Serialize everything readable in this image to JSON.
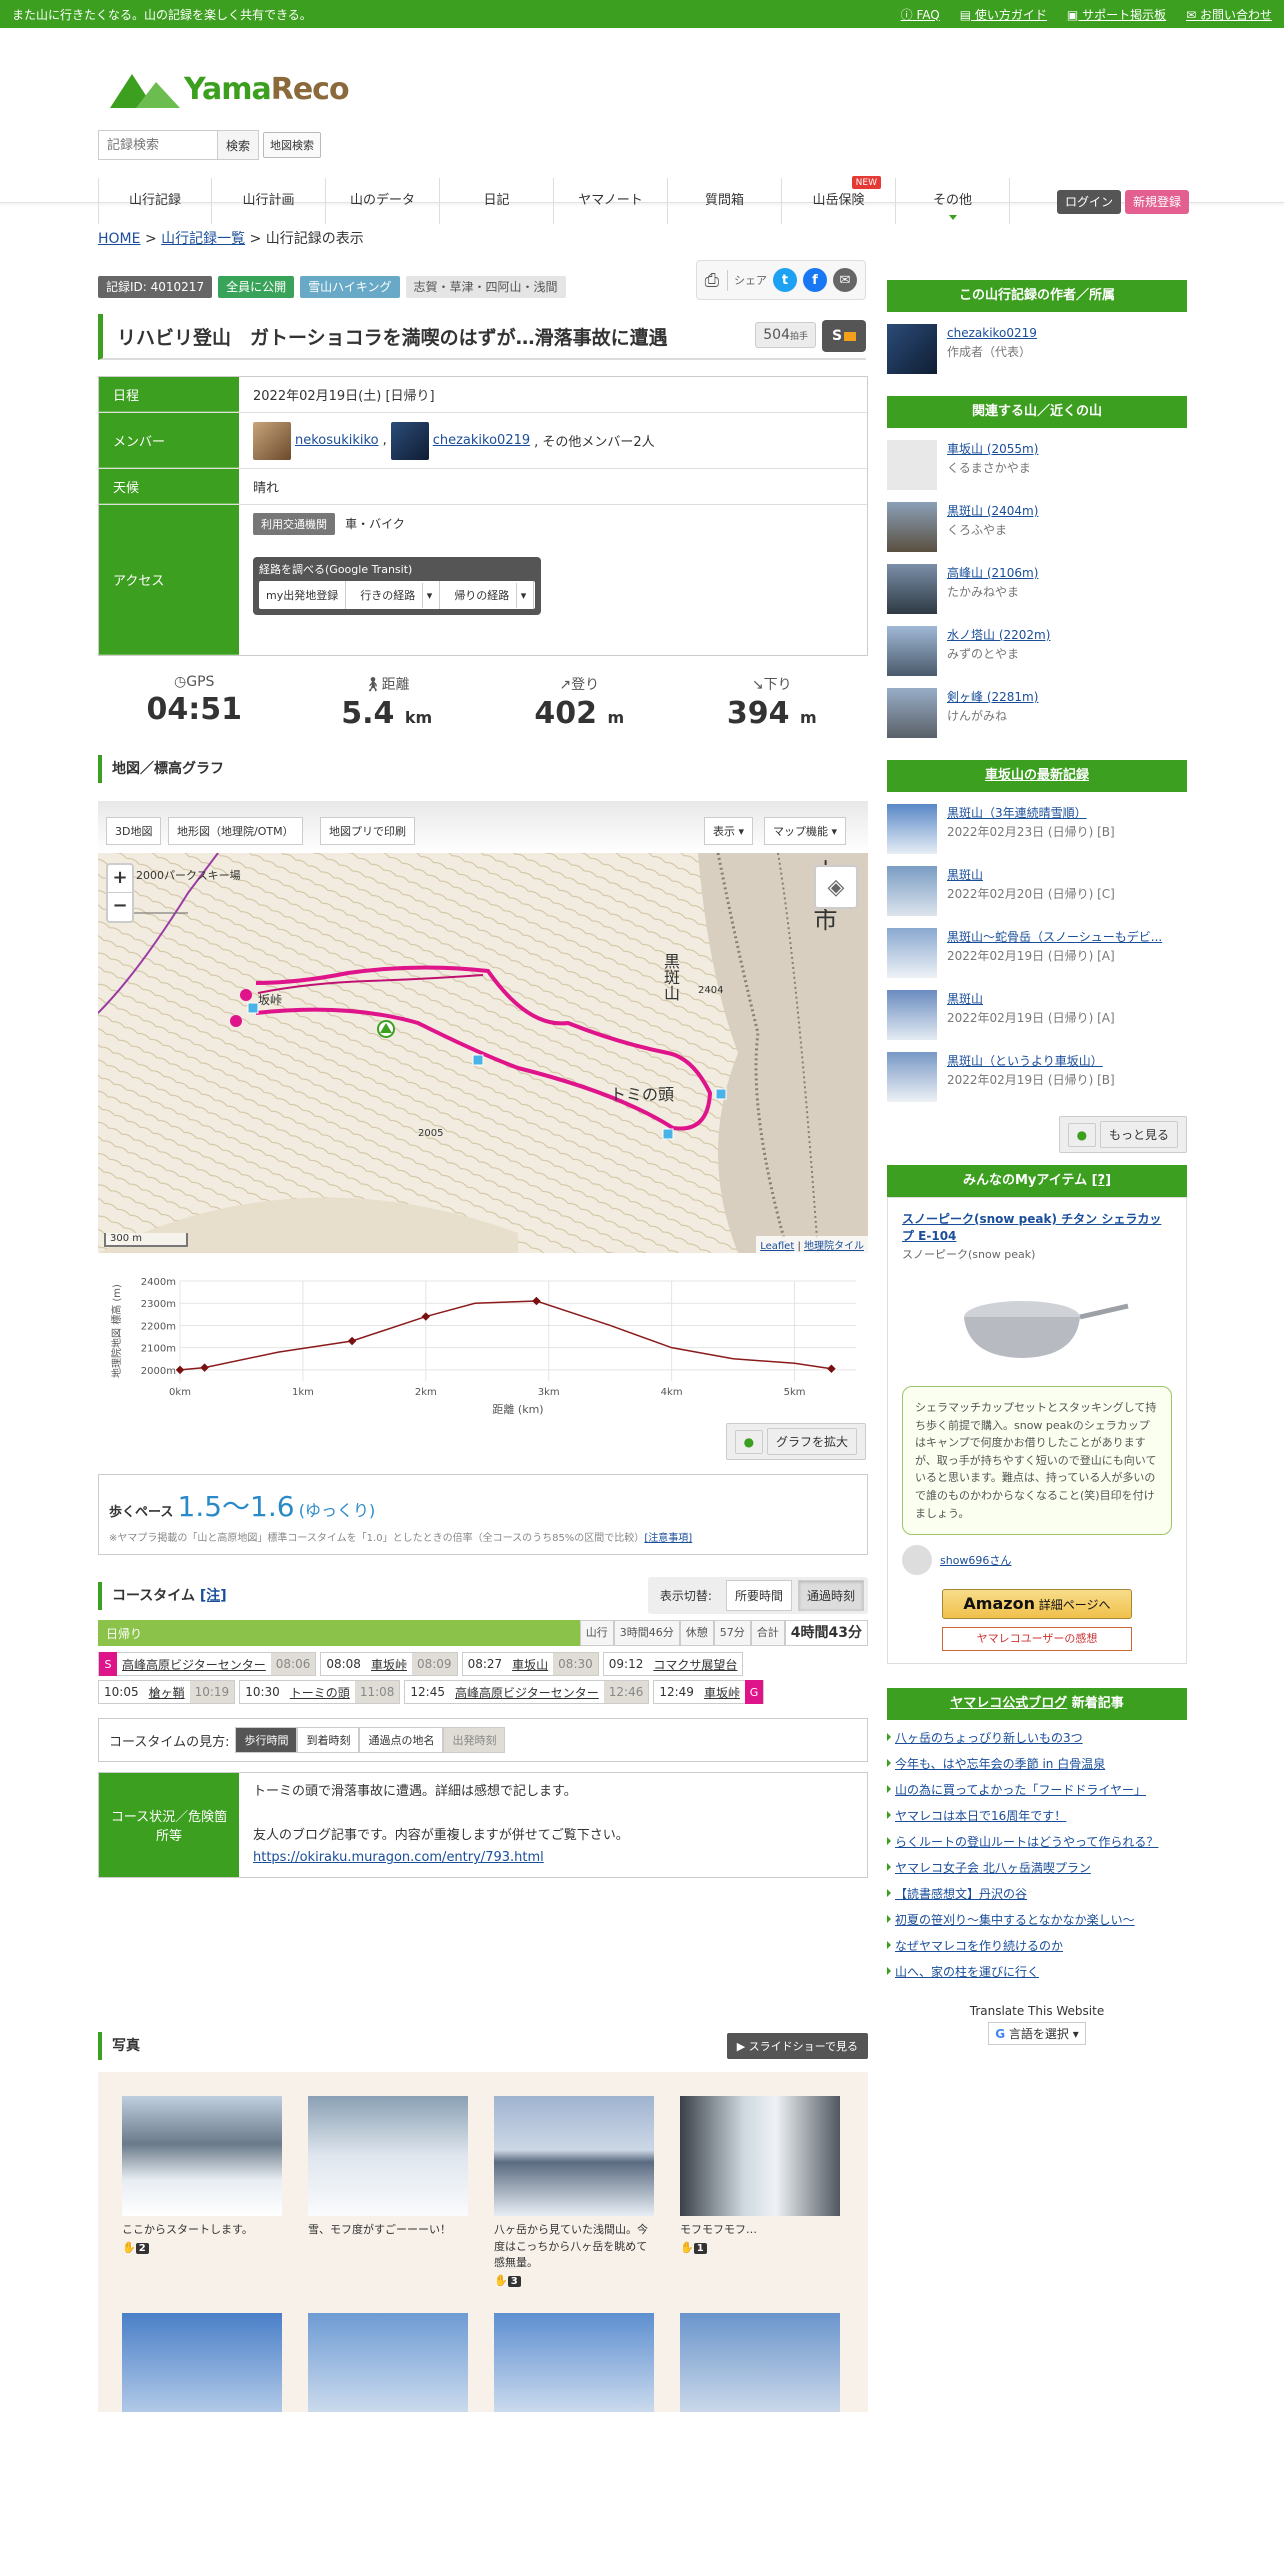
{
  "topbar": {
    "tagline": "また山に行きたくなる。山の記録を楽しく共有できる。",
    "faq": "FAQ",
    "guide": "使い方ガイド",
    "support": "サポート掲示板",
    "contact": "お問い合わせ"
  },
  "header": {
    "logo_a": "Yama",
    "logo_b": "Reco",
    "search_placeholder": "記録検索",
    "search_btn": "検索",
    "map_search": "地図検索",
    "login": "ログイン",
    "register": "新規登録",
    "new_badge": "NEW"
  },
  "nav": [
    "山行記録",
    "山行計画",
    "山のデータ",
    "日記",
    "ヤマノート",
    "質問箱",
    "山岳保険",
    "その他"
  ],
  "breadcrumb": {
    "home": "HOME",
    "list": "山行記録一覧",
    "current": "山行記録の表示",
    "sep": ">"
  },
  "tags": {
    "id": "記録ID: 4010217",
    "public": "全員に公開",
    "type": "雪山ハイキング",
    "area": "志賀・草津・四阿山・浅間"
  },
  "share": {
    "label": "シェア"
  },
  "record": {
    "title": "リハビリ登山　ガトーショコラを満喫のはずが…滑落事故に遭遇",
    "claps": "504",
    "claps_unit": "拍手",
    "s_badge": "S"
  },
  "info": {
    "date_label": "日程",
    "date": "2022年02月19日(土) [日帰り]",
    "member_label": "メンバー",
    "member1": "nekosukikiko",
    "member2": "chezakiko0219",
    "member_rest": ", その他メンバー2人",
    "weather_label": "天候",
    "weather": "晴れ",
    "access_label": "アクセス",
    "transport_btn": "利用交通機関",
    "transport": "車・バイク",
    "transit_title": "経路を調べる(Google Transit)",
    "transit_b1": "my出発地登録",
    "transit_b2": "行きの経路",
    "transit_b3": "帰りの経路",
    "comma": ","
  },
  "stats": [
    {
      "label": "GPS",
      "value": "04:51",
      "unit": "",
      "icon": "clock-icon"
    },
    {
      "label": "距離",
      "value": "5.4",
      "unit": "km",
      "icon": "walker-icon"
    },
    {
      "label": "登り",
      "value": "402",
      "unit": "m",
      "icon": "arrow-up-icon"
    },
    {
      "label": "下り",
      "value": "394",
      "unit": "m",
      "icon": "arrow-down-icon"
    }
  ],
  "map": {
    "heading": "地図／標高グラフ",
    "btn_3d": "3D地図",
    "btn_chiiki": "地形図（地理院/OTM）",
    "btn_app": "地図プリで印刷",
    "btn_show": "表示",
    "btn_func": "マップ機能",
    "zoom_in": "+",
    "zoom_out": "−",
    "label_ski": "2000パークスキー場",
    "label_kuroyama": "黒斑山",
    "label_2404": "2404",
    "label_2005": "2005",
    "label_tomi": "トミの頭",
    "label_city": "小諸市",
    "label_saka": "坂峠",
    "scale": "300 m",
    "attrib_a": "Leaflet",
    "attrib_b": "地理院タイル",
    "attrib_sep": " | "
  },
  "chart_data": {
    "type": "line",
    "x": [
      0,
      0.2,
      0.8,
      1.4,
      2.0,
      2.4,
      2.9,
      3.5,
      4.0,
      4.5,
      5.0,
      5.3
    ],
    "y": [
      2000,
      2010,
      2080,
      2130,
      2240,
      2300,
      2310,
      2200,
      2100,
      2050,
      2030,
      2005
    ],
    "xlabel": "距離 (km)",
    "ylabel": "地理院地図 標高 (m)",
    "ylim": [
      1950,
      2400
    ],
    "xlim": [
      0,
      5.5
    ],
    "xticks": [
      "0km",
      "1km",
      "2km",
      "3km",
      "4km",
      "5km"
    ],
    "yticks": [
      "2000m",
      "2100m",
      "2200m",
      "2300m",
      "2400m"
    ],
    "grid": true
  },
  "graph_enlarge": "グラフを拡大",
  "pace": {
    "label": "歩くペース",
    "value": "1.5～1.6",
    "desc": "(ゆっくり)",
    "note": "※ヤマプラ掲載の「山と高原地図」標準コースタイムを「1.0」としたときの倍率（全コースのうち85%の区間で比較）",
    "note_link": "[注意事項]"
  },
  "course": {
    "heading": "コースタイム",
    "note": "[注]",
    "toggle_label": "表示切替:",
    "t1": "所要時間",
    "t2": "通過時刻",
    "day": "日帰り",
    "c_hike": "山行",
    "c_hike_v": "3時間46分",
    "c_rest": "休憩",
    "c_rest_v": "57分",
    "c_total": "合計",
    "c_total_v": "4時間43分",
    "points": [
      {
        "t": "",
        "p": "高峰高原ビジターセンター",
        "a": "08:06"
      },
      {
        "t": "08:08",
        "p": "車坂峠",
        "a": "08:09"
      },
      {
        "t": "08:27",
        "p": "車坂山",
        "a": "08:30"
      },
      {
        "t": "09:12",
        "p": "コマクサ展望台",
        "a": ""
      },
      {
        "t": "10:05",
        "p": "槍ヶ鞘",
        "a": "10:19"
      },
      {
        "t": "10:30",
        "p": "トーミの頭",
        "a": "11:08"
      },
      {
        "t": "12:45",
        "p": "高峰高原ビジターセンター",
        "a": "12:46"
      },
      {
        "t": "12:49",
        "p": "車坂峠",
        "a": ""
      }
    ],
    "start": "S",
    "goal": "G"
  },
  "legend": {
    "label": "コースタイムの見方:",
    "a": "歩行時間",
    "b": "到着時刻",
    "c": "通過点の地名",
    "d": "出発時刻"
  },
  "situation": {
    "label": "コース状況／危険箇所等",
    "line1": "トーミの頭で滑落事故に遭遇。詳細は感想で記します。",
    "line2": "友人のブログ記事です。内容が重複しますが併せてご覧下さい。",
    "link": "https://okiraku.muragon.com/entry/793.html"
  },
  "photos": {
    "heading": "写真",
    "slideshow": "スライドショーで見る",
    "items": [
      {
        "cap": "ここからスタートします。",
        "likes": "2"
      },
      {
        "cap": "雪、モフ度がすごーーーい！",
        "likes": ""
      },
      {
        "cap": "八ヶ岳から見ていた浅間山。今度はこっちから八ヶ岳を眺めて感無量。",
        "likes": "3"
      },
      {
        "cap": "モフモフモフ…",
        "likes": "1"
      }
    ]
  },
  "side": {
    "author_h": "この山行記録の作者／所属",
    "author": "chezakiko0219",
    "author_role": "作成者（代表）",
    "mount_h": "関連する山／近くの山",
    "mountains": [
      {
        "name": "車坂山 (2055m)",
        "kana": "くるまさかやま"
      },
      {
        "name": "黒斑山 (2404m)",
        "kana": "くろふやま"
      },
      {
        "name": "高峰山 (2106m)",
        "kana": "たかみねやま"
      },
      {
        "name": "水ノ塔山 (2202m)",
        "kana": "みずのとやま"
      },
      {
        "name": "剣ヶ峰 (2281m)",
        "kana": "けんがみね"
      }
    ],
    "latest_h": "車坂山の最新記録",
    "latest": [
      {
        "t": "黒斑山（3年連続晴雪順）",
        "d": "2022年02月23日 (日帰り) [B]"
      },
      {
        "t": "黒斑山",
        "d": "2022年02月20日 (日帰り) [C]"
      },
      {
        "t": "黒斑山〜蛇骨岳（スノーシューもデビ...",
        "d": "2022年02月19日 (日帰り) [A]"
      },
      {
        "t": "黒斑山",
        "d": "2022年02月19日 (日帰り) [A]"
      },
      {
        "t": "黒斑山（というより車坂山）",
        "d": "2022年02月19日 (日帰り) [B]"
      }
    ],
    "more": "もっと見る",
    "items_h": "みんなのMyアイテム",
    "items_q": "[?]",
    "item_name": "スノーピーク(snow peak) チタン シェラカップ E-104",
    "item_brand": "スノーピーク(snow peak)",
    "item_comment": "シェラマッチカップセットとスタッキングして持ち歩く前提で購入。snow peakのシェラカップはキャンプで何度かお借りしたことがありますが、取っ手が持ちやすく短いので登山にも向いていると思います。難点は、持っている人が多いので誰のものかわからなくなること(笑)目印を付けましょう。",
    "item_user": "show696さん",
    "amazon": "Amazon",
    "amazon_sub": "詳細ページへ",
    "review": "ヤマレコユーザーの感想",
    "blog_h_a": "ヤマレコ公式ブログ",
    "blog_h_b": "新着記事",
    "blog": [
      "八ヶ岳のちょっぴり新しいもの3つ",
      "今年も、はや忘年会の季節 in 白骨温泉",
      "山の為に買ってよかった「フードドライヤー」",
      "ヤマレコは本日で16周年です！",
      "らくルートの登山ルートはどうやって作られる？",
      "ヤマレコ女子会 北八ヶ岳満喫プラン",
      "【読書感想文】丹沢の谷",
      "初夏の笹刈り～集中するとなかなか楽しい～",
      "なぜヤマレコを作り続けるのか",
      "山へ、家の柱を運びに行く"
    ],
    "translate": "Translate This Website",
    "lang": "言語を選択"
  }
}
